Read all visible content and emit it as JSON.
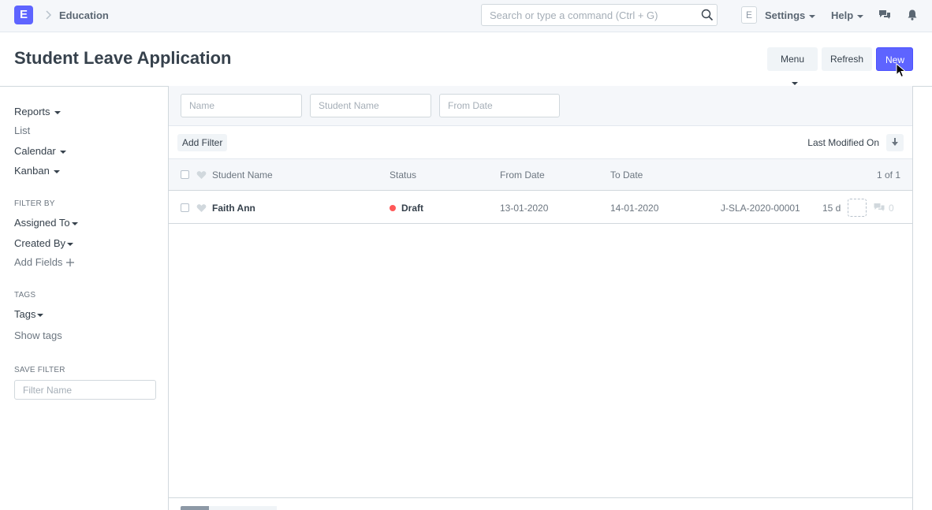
{
  "navbar": {
    "logo_letter": "E",
    "breadcrumb": "Education",
    "search_placeholder": "Search or type a command (Ctrl + G)",
    "avatar_letter": "E",
    "settings_label": "Settings",
    "help_label": "Help"
  },
  "page": {
    "title": "Student Leave Application",
    "menu_label": "Menu",
    "refresh_label": "Refresh",
    "new_label": "New"
  },
  "sidebar": {
    "views": [
      {
        "label": "Reports",
        "dropdown": true
      },
      {
        "label": "List",
        "dropdown": false
      },
      {
        "label": "Calendar",
        "dropdown": true
      },
      {
        "label": "Kanban",
        "dropdown": true
      }
    ],
    "filter_by_heading": "FILTER BY",
    "assigned_to": "Assigned To",
    "created_by": "Created By",
    "add_fields": "Add Fields",
    "tags_heading": "TAGS",
    "tags": "Tags",
    "show_tags": "Show tags",
    "save_filter_heading": "SAVE FILTER",
    "filter_name_placeholder": "Filter Name"
  },
  "filters": {
    "name_placeholder": "Name",
    "student_name_placeholder": "Student Name",
    "from_date_placeholder": "From Date",
    "add_filter": "Add Filter",
    "sort_label": "Last Modified On"
  },
  "list": {
    "columns": {
      "student_name": "Student Name",
      "status": "Status",
      "from_date": "From Date",
      "to_date": "To Date"
    },
    "count": "1 of 1",
    "rows": [
      {
        "student_name": "Faith Ann",
        "status": "Draft",
        "status_color": "#ff5858",
        "from_date": "13-01-2020",
        "to_date": "14-01-2020",
        "id": "J-SLA-2020-00001",
        "modified": "15 d",
        "comments": "0"
      }
    ]
  },
  "colors": {
    "primary": "#5e64ff",
    "navbar_bg": "#f5f7fa",
    "text": "#36414c"
  }
}
